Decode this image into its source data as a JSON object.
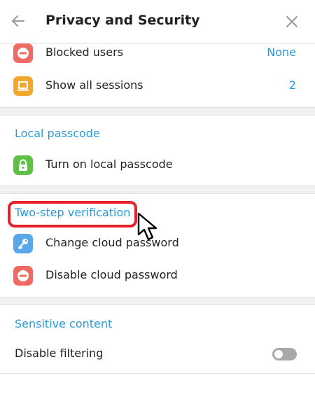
{
  "header": {
    "title": "Privacy and Security",
    "back_icon": "arrow-left-icon",
    "close_icon": "close-icon"
  },
  "security_rows": [
    {
      "label": "Blocked users",
      "value": "None",
      "icon": "block-icon",
      "icon_color": "#ef6a63"
    },
    {
      "label": "Show all sessions",
      "value": "2",
      "icon": "laptop-icon",
      "icon_color": "#f1a72e"
    }
  ],
  "local_passcode": {
    "title": "Local passcode",
    "row": {
      "label": "Turn on local passcode",
      "icon": "lock-icon",
      "icon_color": "#5fc144"
    }
  },
  "two_step": {
    "title": "Two-step verification",
    "rows": [
      {
        "label": "Change cloud password",
        "icon": "key-icon",
        "icon_color": "#57a7ea"
      },
      {
        "label": "Disable cloud password",
        "icon": "block-icon",
        "icon_color": "#ef6a63"
      }
    ]
  },
  "sensitive_content": {
    "title": "Sensitive content",
    "filter_label": "Disable filtering",
    "filter_enabled": false
  },
  "colors": {
    "accent": "#2a9bd6",
    "highlight": "#e8202a",
    "separator": "#f1f1f1"
  }
}
